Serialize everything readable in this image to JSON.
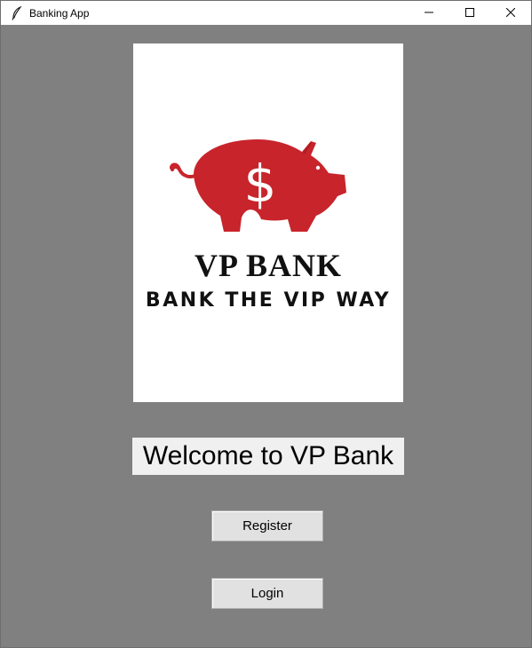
{
  "window": {
    "title": "Banking App",
    "app_icon": "feather-icon",
    "controls": [
      "minimize-icon",
      "maximize-icon",
      "close-icon"
    ]
  },
  "logo": {
    "brand_name": "VP BANK",
    "tagline": "BANK THE VIP WAY",
    "icon": "piggy-bank-icon",
    "icon_symbol": "$",
    "brand_color": "#c8242b"
  },
  "welcome_text": "Welcome to VP Bank",
  "buttons": {
    "register": "Register",
    "login": "Login"
  },
  "colors": {
    "background": "#808080",
    "button_face": "#e1e1e1",
    "welcome_bg": "#f0f0f0"
  }
}
